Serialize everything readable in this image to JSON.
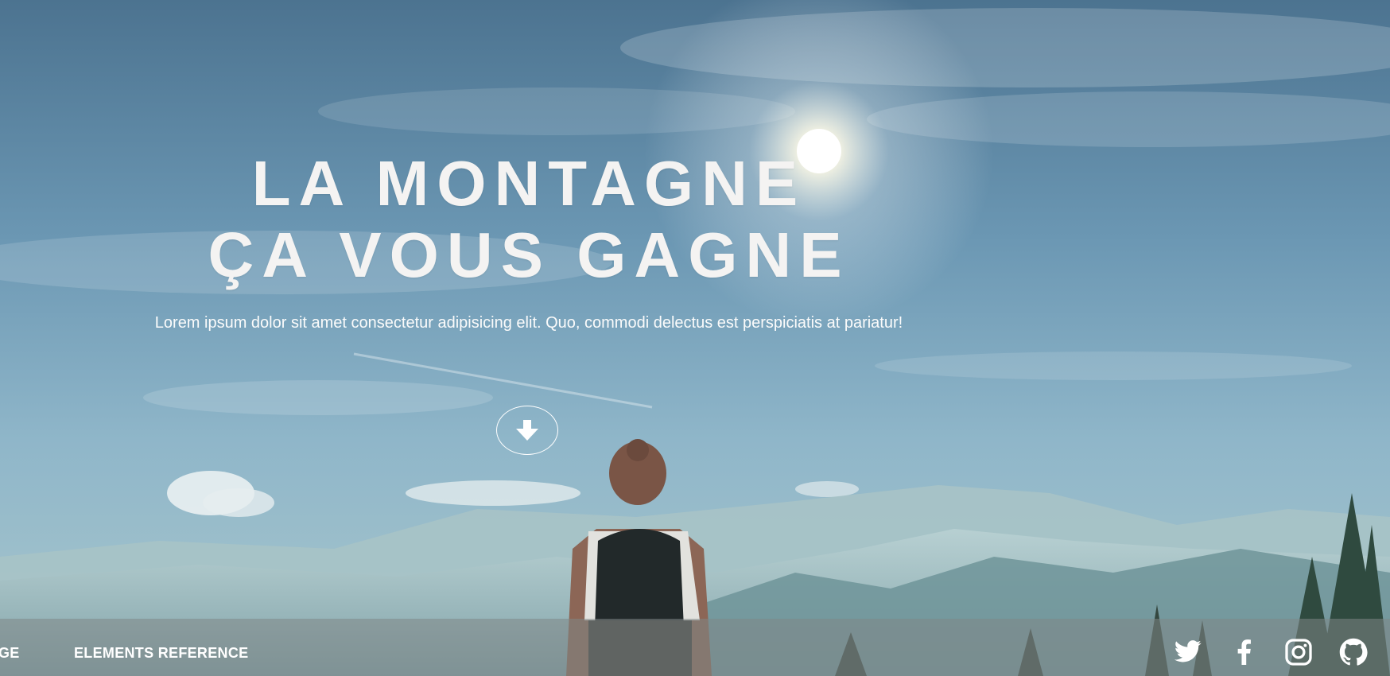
{
  "hero": {
    "title_line1": "LA MONTAGNE",
    "title_line2": "ÇA VOUS GAGNE",
    "subtitle": "Lorem ipsum dolor sit amet consectetur adipisicing elit. Quo, commodi delectus est perspiciatis at pariatur!",
    "scroll_icon": "arrow-down-icon"
  },
  "footer": {
    "nav": [
      {
        "label": "GE"
      },
      {
        "label": "ELEMENTS REFERENCE"
      }
    ],
    "social": [
      "twitter-icon",
      "facebook-icon",
      "instagram-icon",
      "github-icon"
    ]
  },
  "colors": {
    "sky_top": "#4f7896",
    "sky_mid": "#7ba4bd",
    "mountain_haze": "#a8c4c8",
    "text": "#ffffff"
  }
}
